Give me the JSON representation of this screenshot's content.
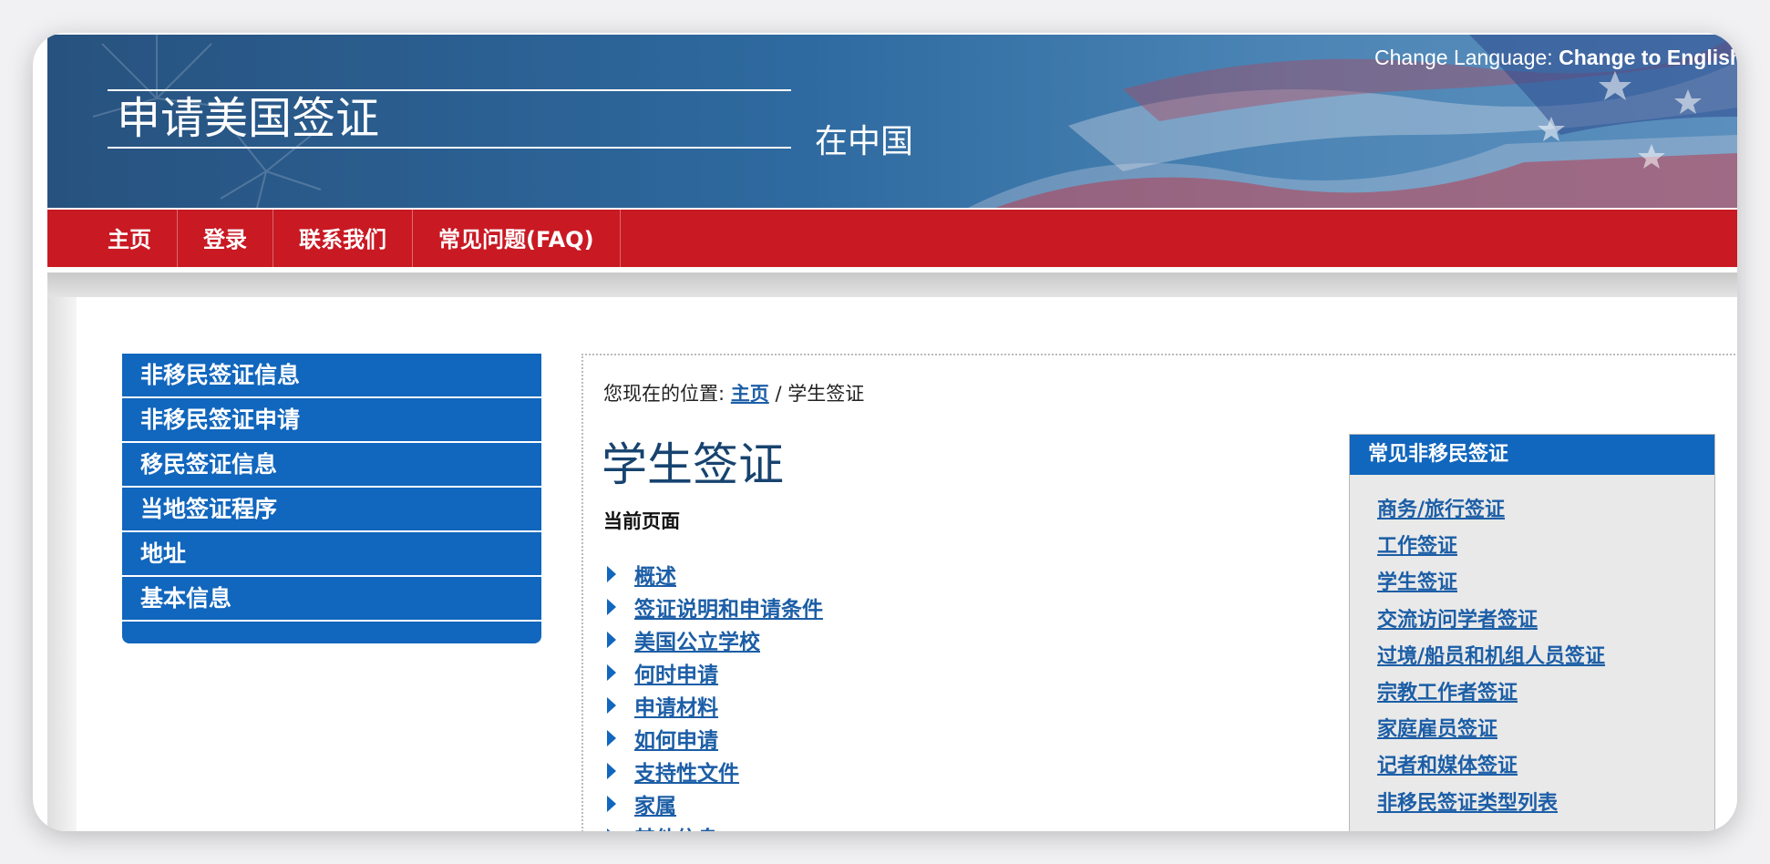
{
  "header": {
    "title": "申请美国签证",
    "subtitle": "在中国",
    "language_label": "Change Language:",
    "language_link": "Change to English"
  },
  "nav": {
    "items": [
      {
        "label": "主页"
      },
      {
        "label": "登录"
      },
      {
        "label": "联系我们"
      },
      {
        "label": "常见问题(FAQ)"
      }
    ]
  },
  "sidebar": {
    "items": [
      {
        "label": "非移民签证信息"
      },
      {
        "label": "非移民签证申请"
      },
      {
        "label": "移民签证信息"
      },
      {
        "label": "当地签证程序"
      },
      {
        "label": "地址"
      },
      {
        "label": "基本信息"
      }
    ]
  },
  "main": {
    "breadcrumb_prefix": "您现在的位置:",
    "breadcrumb_home": "主页",
    "breadcrumb_sep": "/",
    "breadcrumb_current": "学生签证",
    "title": "学生签证",
    "current_page_label": "当前页面",
    "links": [
      "概述",
      "签证说明和申请条件",
      "美国公立学校",
      "何时申请",
      "申请材料",
      "如何申请",
      "支持性文件",
      "家属",
      "其他信息"
    ]
  },
  "faq": {
    "title": "常见非移民签证",
    "links": [
      "商务/旅行签证",
      "工作签证",
      "学生签证",
      "交流访问学者签证",
      "过境/船员和机组人员签证",
      "宗教工作者签证",
      "家庭雇员签证",
      "记者和媒体签证",
      "非移民签证类型列表"
    ]
  },
  "colors": {
    "nav_red": "#c91923",
    "accent_blue": "#1166bd",
    "link_blue": "#1c5ea6",
    "title_navy": "#17436f"
  }
}
